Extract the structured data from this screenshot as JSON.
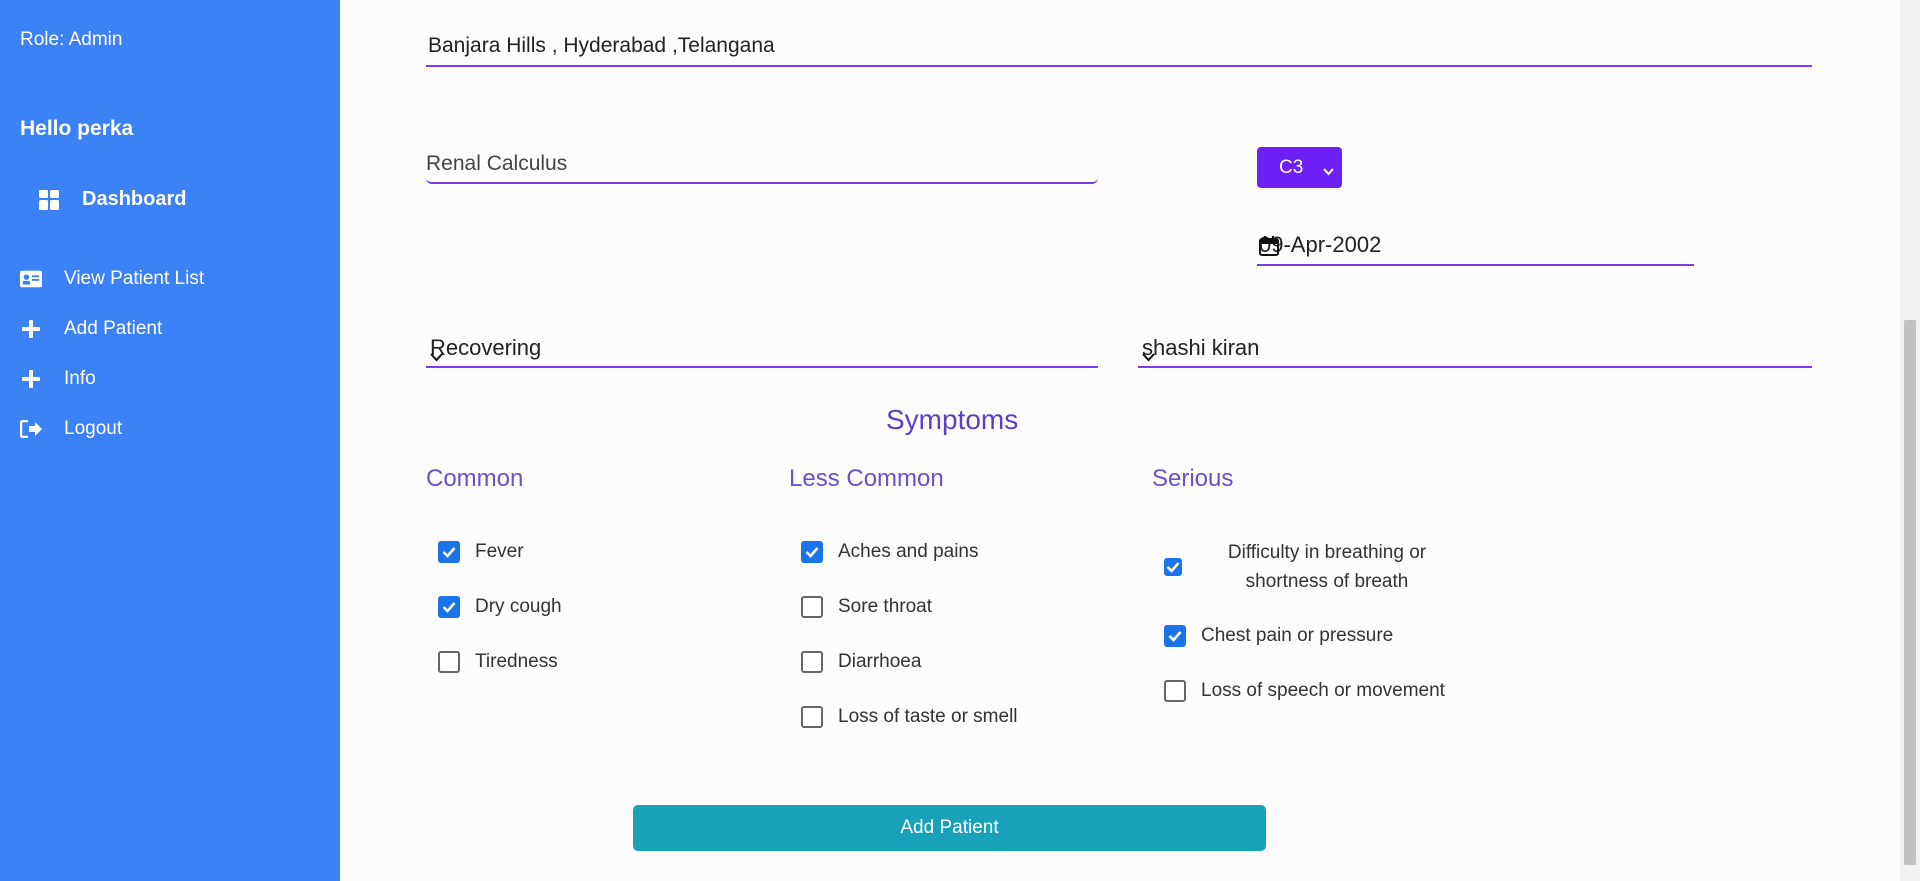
{
  "sidebar": {
    "role": "Role: Admin",
    "greeting": "Hello perka",
    "items": [
      {
        "label": "Dashboard",
        "icon": "dashboard-grid-icon"
      },
      {
        "label": "View Patient List",
        "icon": "id-card-icon"
      },
      {
        "label": "Add Patient",
        "icon": "plus-icon"
      },
      {
        "label": "Info",
        "icon": "plus-icon"
      },
      {
        "label": "Logout",
        "icon": "sign-out-icon"
      }
    ]
  },
  "form": {
    "address": "Banjara Hills , Hyderabad ,Telangana",
    "disease": "Renal Calculus",
    "stage": "C3",
    "date": "09-Apr-2002",
    "status": "Recovering",
    "doctor": "shashi kiran"
  },
  "symptoms": {
    "title": "Symptoms",
    "common": {
      "heading": "Common",
      "items": [
        {
          "label": "Fever",
          "checked": true
        },
        {
          "label": "Dry cough",
          "checked": true
        },
        {
          "label": "Tiredness",
          "checked": false
        }
      ]
    },
    "less_common": {
      "heading": "Less Common",
      "items": [
        {
          "label": "Aches and pains",
          "checked": true
        },
        {
          "label": "Sore throat",
          "checked": false
        },
        {
          "label": "Diarrhoea",
          "checked": false
        },
        {
          "label": "Loss of taste or smell",
          "checked": false
        }
      ]
    },
    "serious": {
      "heading": "Serious",
      "items": [
        {
          "label": "Difficulty in breathing or shortness of breath",
          "checked": true
        },
        {
          "label": "Chest pain or pressure",
          "checked": true
        },
        {
          "label": "Loss of speech or movement",
          "checked": false
        }
      ]
    }
  },
  "submit_label": "Add Patient",
  "colors": {
    "sidebar": "#3b82f6",
    "accent": "#7c3aed",
    "stage_button": "#6d1ff5",
    "submit": "#17a2b8",
    "checkbox": "#1a73e8"
  }
}
